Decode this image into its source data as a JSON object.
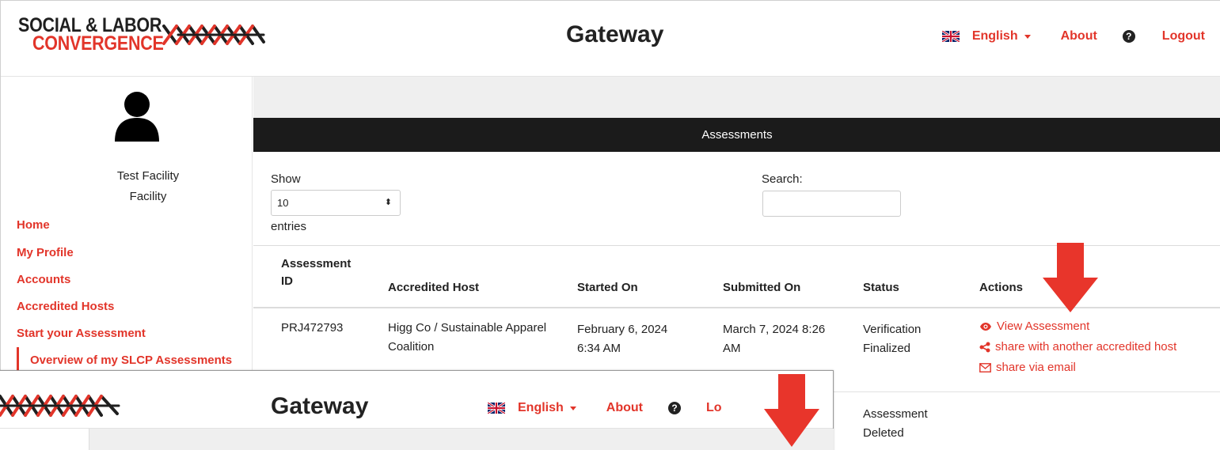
{
  "app": {
    "logo_line1": "SOCIAL & LABOR",
    "logo_line2": "CONVERGENCE",
    "title": "Gateway"
  },
  "nav": {
    "language": "English",
    "about": "About",
    "help_icon": "question-circle-icon",
    "logout": "Logout"
  },
  "sidebar": {
    "user_name": "Test Facility",
    "user_role": "Facility",
    "items": [
      {
        "label": "Home"
      },
      {
        "label": "My Profile"
      },
      {
        "label": "Accounts"
      },
      {
        "label": "Accredited Hosts"
      },
      {
        "label": "Start your Assessment"
      },
      {
        "label": "Overview of my SLCP Assessments",
        "active": true
      }
    ]
  },
  "panel": {
    "title": "Assessments",
    "show_label": "Show",
    "entries_value": "10",
    "entries_label": "entries",
    "search_label": "Search:",
    "search_value": ""
  },
  "table": {
    "headers": [
      "Assessment ID",
      "Accredited Host",
      "Started On",
      "Submitted On",
      "Status",
      "Actions"
    ],
    "header_id_line1": "Assessment",
    "header_id_line2": "ID",
    "rows": [
      {
        "id": "PRJ472793",
        "host_line1": "Higg Co / Sustainable Apparel",
        "host_line2": "Coalition",
        "started_line1": "February 6, 2024",
        "started_line2": "6:34 AM",
        "submitted_line1": "March 7, 2024 8:26",
        "submitted_line2": "AM",
        "status_line1": "Verification",
        "status_line2": "Finalized",
        "actions": [
          "View Assessment",
          "share with another accredited host",
          "share via email"
        ]
      },
      {
        "status_line1": "Assessment",
        "status_line2": "Deleted"
      }
    ]
  },
  "overlay": {
    "title": "Gateway",
    "language": "English",
    "about": "About",
    "logout_partial": "Lo"
  },
  "colors": {
    "brand_red": "#e2352a",
    "header_black": "#1b1b1b",
    "gray_bar": "#efefef",
    "annotation_arrow": "#e8352b"
  }
}
